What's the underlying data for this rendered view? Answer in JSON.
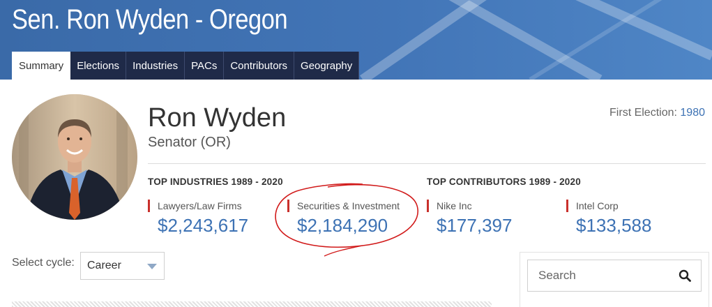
{
  "header": {
    "title": "Sen. Ron Wyden - Oregon"
  },
  "tabs": [
    {
      "label": "Summary",
      "active": true
    },
    {
      "label": "Elections",
      "active": false
    },
    {
      "label": "Industries",
      "active": false
    },
    {
      "label": "PACs",
      "active": false
    },
    {
      "label": "Contributors",
      "active": false
    },
    {
      "label": "Geography",
      "active": false
    }
  ],
  "profile": {
    "name": "Ron Wyden",
    "role": "Senator (OR)",
    "first_election_label": "First Election:",
    "first_election_year": "1980"
  },
  "top_industries": {
    "heading": "TOP INDUSTRIES 1989 - 2020",
    "items": [
      {
        "label": "Lawyers/Law Firms",
        "value": "$2,243,617"
      },
      {
        "label": "Securities & Investment",
        "value": "$2,184,290"
      }
    ]
  },
  "top_contributors": {
    "heading": "TOP CONTRIBUTORS 1989 - 2020",
    "items": [
      {
        "label": "Nike Inc",
        "value": "$177,397"
      },
      {
        "label": "Intel Corp",
        "value": "$133,588"
      }
    ]
  },
  "cycle": {
    "label": "Select cycle:",
    "selected": "Career"
  },
  "search": {
    "placeholder": "Search"
  },
  "colors": {
    "banner": "#4275b7",
    "tab_dark": "#1f2a48",
    "accent_blue": "#3d72b4",
    "stat_bar_red": "#c9302c",
    "annotation_red": "#d11a1a"
  },
  "icons": {
    "search": "magnifier-icon",
    "dropdown": "caret-down-icon"
  }
}
